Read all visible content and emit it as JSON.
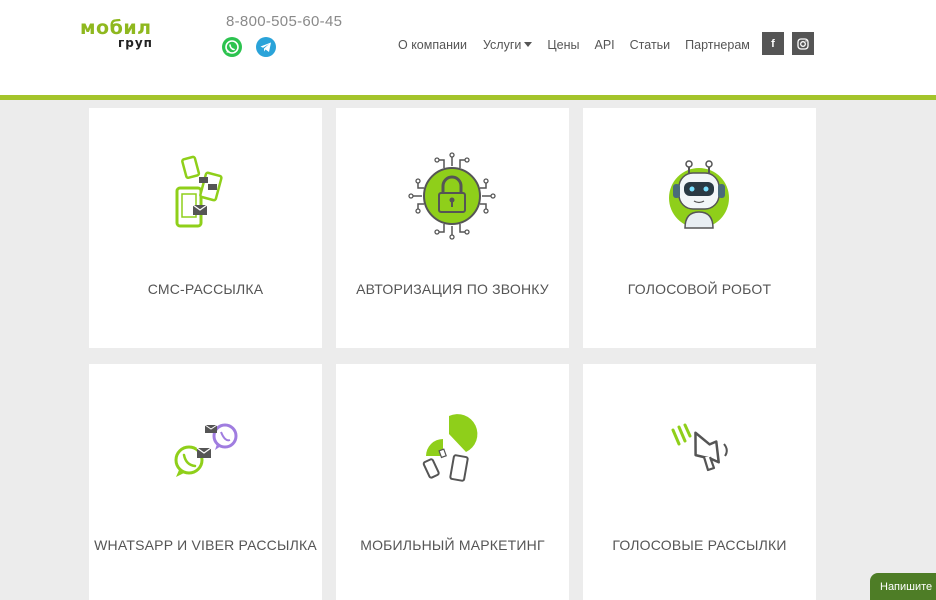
{
  "header": {
    "logo_top": "мобил",
    "logo_bottom": "груп",
    "phone": "8-800-505-60-45",
    "messengers": [
      "whatsapp-icon",
      "telegram-icon"
    ],
    "nav": [
      {
        "label": "О компании"
      },
      {
        "label": "Услуги",
        "dropdown": true
      },
      {
        "label": "Цены"
      },
      {
        "label": "API"
      },
      {
        "label": "Статьи"
      },
      {
        "label": "Партнерам"
      }
    ],
    "social": [
      {
        "name": "facebook-icon",
        "glyph": "f"
      },
      {
        "name": "instagram-icon",
        "glyph": "◎"
      }
    ]
  },
  "colors": {
    "accent": "#a4c42b",
    "logo_green": "#8fb81f",
    "icon_green": "#8fcf1a",
    "chat_button": "#4e7d26"
  },
  "services": [
    {
      "title": "СМС-РАССЫЛКА",
      "icon": "sms-phones-icon"
    },
    {
      "title": "АВТОРИЗАЦИЯ ПО ЗВОНКУ",
      "icon": "padlock-icon"
    },
    {
      "title": "ГОЛОСОВОЙ РОБОТ",
      "icon": "robot-icon"
    },
    {
      "title": "WHATSAPP И VIBER РАССЫЛКА",
      "icon": "whatsapp-viber-icon"
    },
    {
      "title": "МОБИЛЬНЫЙ МАРКЕТИНГ",
      "icon": "pie-chart-phones-icon"
    },
    {
      "title": "ГОЛОСОВЫЕ РАССЫЛКИ",
      "icon": "megaphone-icon"
    }
  ],
  "chat_widget": {
    "label": "Напишите нам"
  }
}
